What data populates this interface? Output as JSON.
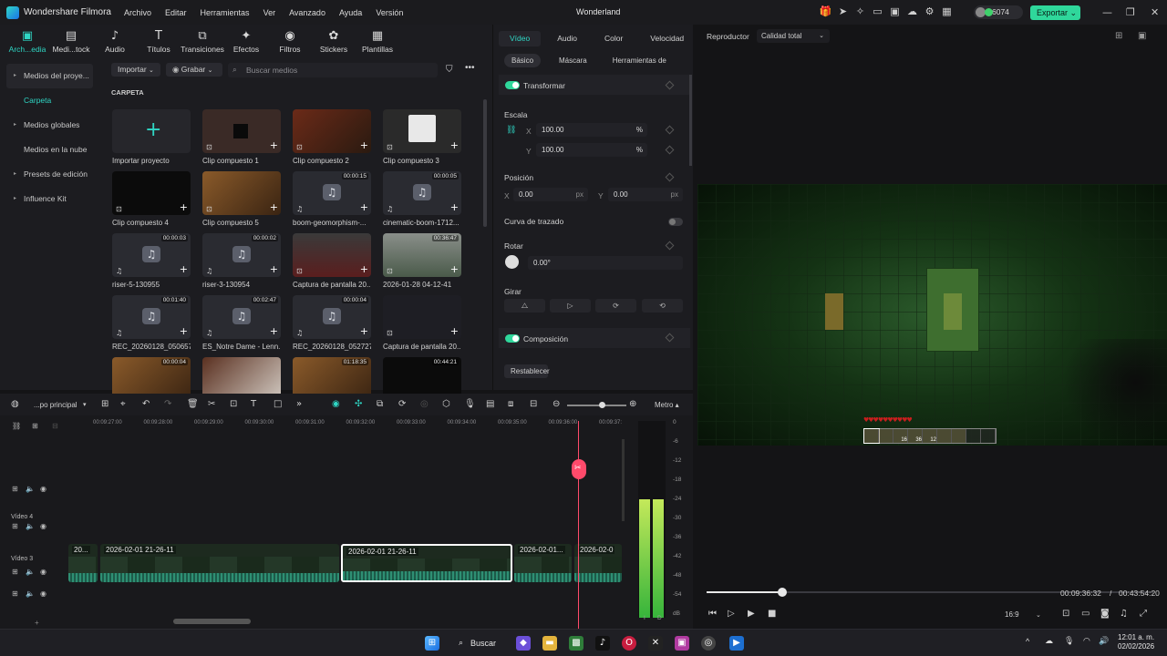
{
  "app": {
    "name": "Wonder­share Filmora",
    "project": "Wonderland",
    "menus": [
      "Archivo",
      "Editar",
      "Herramientas",
      "Ver",
      "Avanzado",
      "Ayuda",
      "Versión"
    ],
    "credits": "6074",
    "export": "Exportar"
  },
  "media": {
    "tabs": [
      {
        "label": "Arch...edia",
        "icon": "▣"
      },
      {
        "label": "Medi...tock",
        "icon": "▤"
      },
      {
        "label": "Audio",
        "icon": "♪"
      },
      {
        "label": "Títulos",
        "icon": "T"
      },
      {
        "label": "Transiciones",
        "icon": "⧉"
      },
      {
        "label": "Efectos",
        "icon": "✦"
      },
      {
        "label": "Filtros",
        "icon": "◉"
      },
      {
        "label": "Stickers",
        "icon": "✿"
      },
      {
        "label": "Plantillas",
        "icon": "▦"
      }
    ],
    "sidebar": [
      {
        "label": "Medios del proye...",
        "arrow": "▸"
      },
      {
        "label": "Carpeta",
        "arrow": ""
      },
      {
        "label": "Medios globales",
        "arrow": "▸"
      },
      {
        "label": "Medios en la nube",
        "arrow": ""
      },
      {
        "label": "Presets de edición",
        "arrow": "▸"
      },
      {
        "label": "Influence Kit",
        "arrow": "▸"
      }
    ],
    "import": "Importar",
    "record": "Grabar",
    "search_placeholder": "Buscar medios",
    "folder_label": "CARPETA",
    "items": [
      {
        "name": "Importar proyecto",
        "duration": "",
        "kind": "import"
      },
      {
        "name": "Clip compuesto 1",
        "duration": "",
        "kind": "dark"
      },
      {
        "name": "Clip compuesto 2",
        "duration": "",
        "kind": "red"
      },
      {
        "name": "Clip compuesto 3",
        "duration": "",
        "kind": "doc"
      },
      {
        "name": "Clip compuesto 4",
        "duration": "",
        "kind": "black"
      },
      {
        "name": "Clip compuesto 5",
        "duration": "",
        "kind": "wood"
      },
      {
        "name": "boom-geomorphism-...",
        "duration": "00:00:15",
        "kind": "audio"
      },
      {
        "name": "cinematic-boom-1712...",
        "duration": "00:00:05",
        "kind": "audio"
      },
      {
        "name": "riser-5-130955",
        "duration": "00:00:03",
        "kind": "audio"
      },
      {
        "name": "riser-3-130954",
        "duration": "00:00:02",
        "kind": "audio"
      },
      {
        "name": "Captura de pantalla 20...",
        "duration": "",
        "kind": "screen"
      },
      {
        "name": "2026-01-28 04-12-41",
        "duration": "00:36:47",
        "kind": "video"
      },
      {
        "name": "REC_20260128_050657",
        "duration": "00:01:40",
        "kind": "audio"
      },
      {
        "name": "ES_Notre Dame - Lenn...",
        "duration": "00:02:47",
        "kind": "audio"
      },
      {
        "name": "REC_20260128_052727",
        "duration": "00:00:04",
        "kind": "audio"
      },
      {
        "name": "Captura de pantalla 20...",
        "duration": "",
        "kind": "dim"
      },
      {
        "name": "",
        "duration": "00:00:04",
        "kind": "wood"
      },
      {
        "name": "",
        "duration": "",
        "kind": "white"
      },
      {
        "name": "",
        "duration": "01:18:35",
        "kind": "wood"
      },
      {
        "name": "",
        "duration": "00:44:21",
        "kind": "black"
      }
    ]
  },
  "props": {
    "tabs": [
      "Vídeo",
      "Audio",
      "Color",
      "Velocidad"
    ],
    "subtabs": [
      "Básico",
      "Máscara",
      "Herramientas de"
    ],
    "transform": "Transformar",
    "scale": "Escala",
    "x_label": "X",
    "y_label": "Y",
    "scale_x": "100.00",
    "scale_y": "100.00",
    "pct": "%",
    "position": "Posición",
    "pos_x": "0.00",
    "pos_y": "0.00",
    "px": "px",
    "curve": "Curva de trazado",
    "rotate": "Rotar",
    "rotate_val": "0.00°",
    "flip": "Girar",
    "composition": "Composición",
    "reset": "Restablecer"
  },
  "player": {
    "label": "Reproductor",
    "quality": "Calidad total",
    "current": "00:09:36:32",
    "sep": "/",
    "total": "00:43:54:20",
    "ratio": "16:9",
    "progress": 0.17
  },
  "timeline": {
    "track_name": "...po principal",
    "meter": "Metro",
    "ruler": [
      "00:09:27:00",
      "00:09:28:00",
      "00:09:29:00",
      "00:09:30:00",
      "00:09:31:00",
      "00:09:32:00",
      "00:09:33:00",
      "00:09:34:00",
      "00:09:35:00",
      "00:09:36:00",
      "00:09:37:"
    ],
    "tracks": [
      "Vídeo 4",
      "Vídeo 3"
    ],
    "clips": [
      "20...",
      "2026-02-01 21-26-11",
      "2026-02-01 21-26-11",
      "2026-02-01...",
      "2026-02-0"
    ],
    "db": [
      "0",
      "-6",
      "-12",
      "-18",
      "-24",
      "-30",
      "-36",
      "-42",
      "-48",
      "-54",
      "dB"
    ],
    "lr": [
      "I",
      "D"
    ]
  },
  "taskbar": {
    "search": "Buscar",
    "time": "12:01 a. m.",
    "date": "02/02/2026"
  }
}
